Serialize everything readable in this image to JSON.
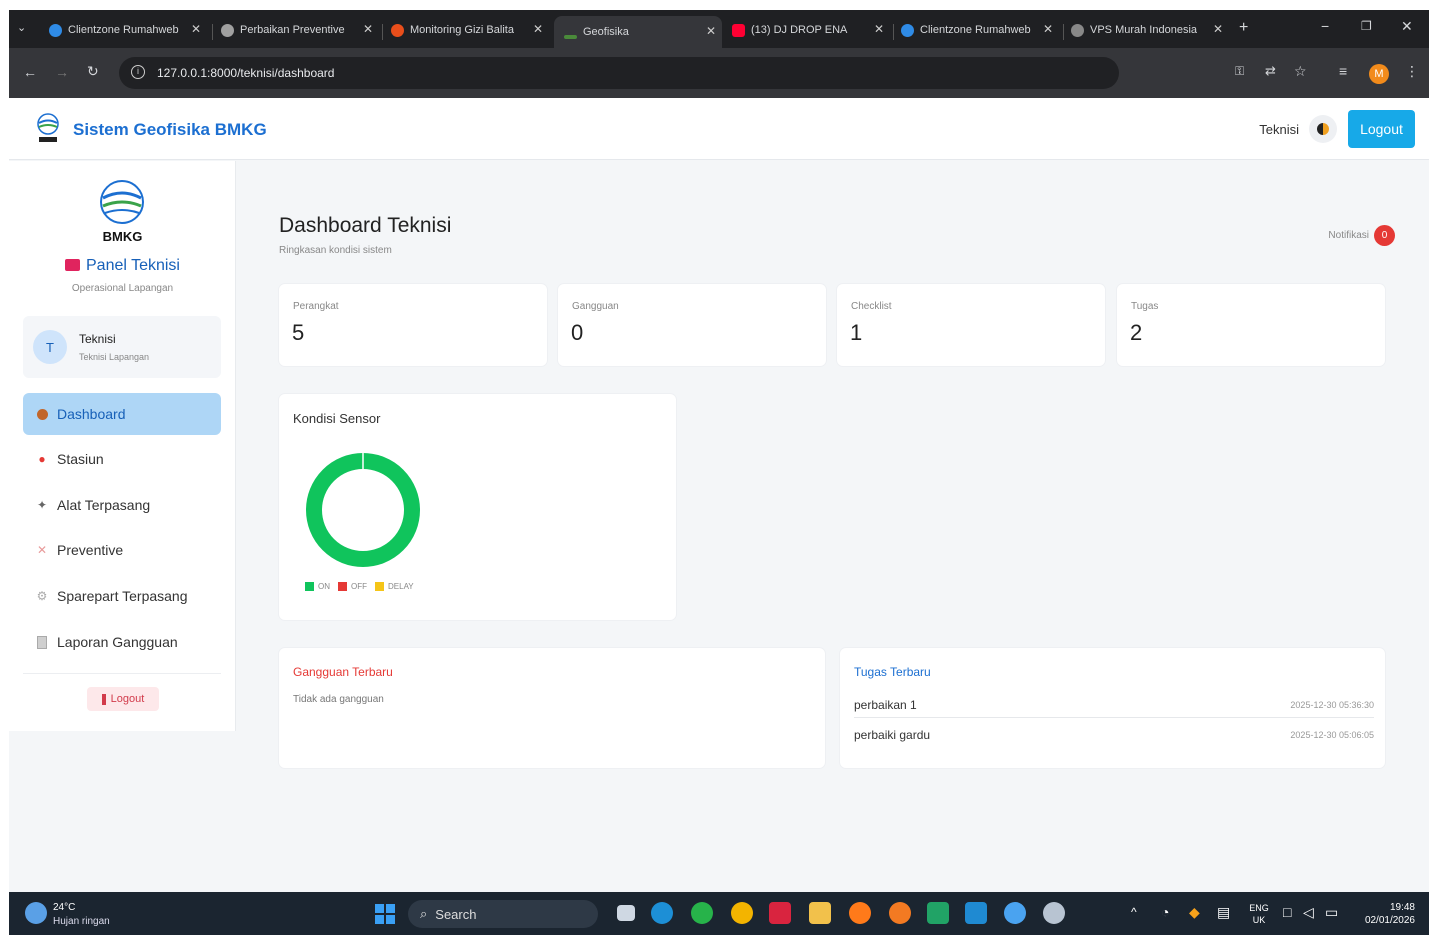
{
  "browser": {
    "tabs": [
      {
        "title": "Clientzone Rumahweb",
        "color": "#2f8be6"
      },
      {
        "title": "Perbaikan Preventive",
        "color": "#a0a0a0"
      },
      {
        "title": "Monitoring Gizi Balita",
        "color": "#e94e1b"
      },
      {
        "title": "Geofisika",
        "color": "#4a8a3a"
      },
      {
        "title": "(13) DJ DROP ENA",
        "color": "#ff0033"
      },
      {
        "title": "Clientzone Rumahweb",
        "color": "#2f8be6"
      },
      {
        "title": "VPS Murah Indonesia",
        "color": "#888888"
      }
    ],
    "url": "127.0.0.1:8000/teknisi/dashboard",
    "profile_initial": "M"
  },
  "header": {
    "brand": "Sistem Geofisika BMKG",
    "user_role": "Teknisi",
    "logout_label": "Logout"
  },
  "sidebar": {
    "logo_text": "BMKG",
    "panel_title": "Panel Teknisi",
    "panel_subtitle": "Operasional Lapangan",
    "user_initial": "T",
    "user_name": "Teknisi",
    "user_role": "Teknisi Lapangan",
    "items": [
      {
        "label": "Dashboard",
        "icon": "user-icon"
      },
      {
        "label": "Stasiun",
        "icon": "pin-icon"
      },
      {
        "label": "Alat Terpasang",
        "icon": "tools-icon"
      },
      {
        "label": "Preventive",
        "icon": "wrench-icon"
      },
      {
        "label": "Sparepart Terpasang",
        "icon": "gear-icon"
      },
      {
        "label": "Laporan Gangguan",
        "icon": "clipboard-icon"
      }
    ],
    "logout_label": "Logout"
  },
  "main": {
    "title": "Dashboard Teknisi",
    "subtitle": "Ringkasan kondisi sistem",
    "notif_label": "Notifikasi",
    "notif_count": "0",
    "stats": [
      {
        "label": "Perangkat",
        "value": "5"
      },
      {
        "label": "Gangguan",
        "value": "0"
      },
      {
        "label": "Checklist",
        "value": "1"
      },
      {
        "label": "Tugas",
        "value": "2"
      }
    ],
    "sensor_title": "Kondisi Sensor",
    "gangguan_title": "Gangguan Terbaru",
    "gangguan_empty": "Tidak ada gangguan",
    "tugas_title": "Tugas Terbaru",
    "tugas": [
      {
        "name": "perbaikan 1",
        "time": "2025-12-30 05:36:30"
      },
      {
        "name": "perbaiki gardu",
        "time": "2025-12-30 05:06:05"
      }
    ]
  },
  "chart_data": {
    "type": "pie",
    "title": "Kondisi Sensor",
    "categories": [
      "ON",
      "OFF",
      "DELAY"
    ],
    "values": [
      5,
      0,
      0
    ],
    "colors": [
      "#10c45c",
      "#e53935",
      "#f5c518"
    ],
    "legend_position": "bottom"
  },
  "taskbar": {
    "weather_temp": "24°C",
    "weather_desc": "Hujan ringan",
    "search_label": "Search",
    "lang_top": "ENG",
    "lang_bottom": "UK",
    "time": "19:48",
    "date": "02/01/2026"
  }
}
